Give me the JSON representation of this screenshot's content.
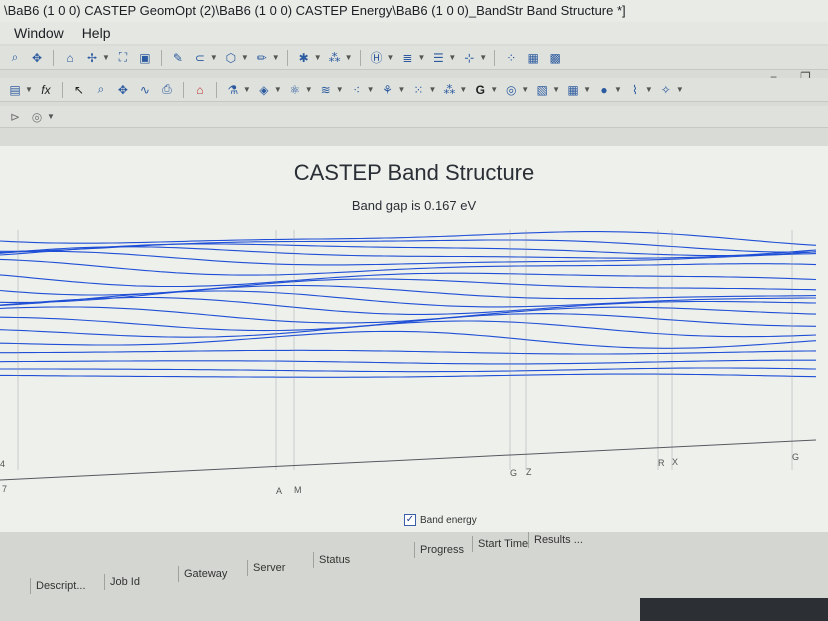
{
  "window": {
    "title": "\\BaB6 (1 0 0) CASTEP GeomOpt (2)\\BaB6 (1 0 0) CASTEP Energy\\BaB6 (1 0 0)_BandStr Band Structure *]"
  },
  "menu": {
    "items": [
      "Window",
      "Help"
    ]
  },
  "chart": {
    "title": "CASTEP Band Structure",
    "subtitle": "Band gap is 0.167 eV",
    "legend_label": "Band energy"
  },
  "chart_data": {
    "type": "line",
    "title": "CASTEP Band Structure",
    "subtitle": "Band gap is 0.167 eV",
    "x_labels": [
      "Z",
      "A",
      "M",
      "G",
      "Z",
      "R",
      "X",
      "G"
    ],
    "y_labels": [
      "4",
      "7"
    ],
    "series": [
      {
        "name": "Band energy",
        "values": []
      }
    ],
    "grid": true,
    "legend": "bottom-center"
  },
  "jobs": {
    "columns": [
      "Descript...",
      "Job Id",
      "Gateway",
      "Server",
      "Status",
      "Progress",
      "Start Time",
      "Results ..."
    ]
  },
  "colors": {
    "band": "#1f4fd6",
    "grid": "#8e9299"
  }
}
